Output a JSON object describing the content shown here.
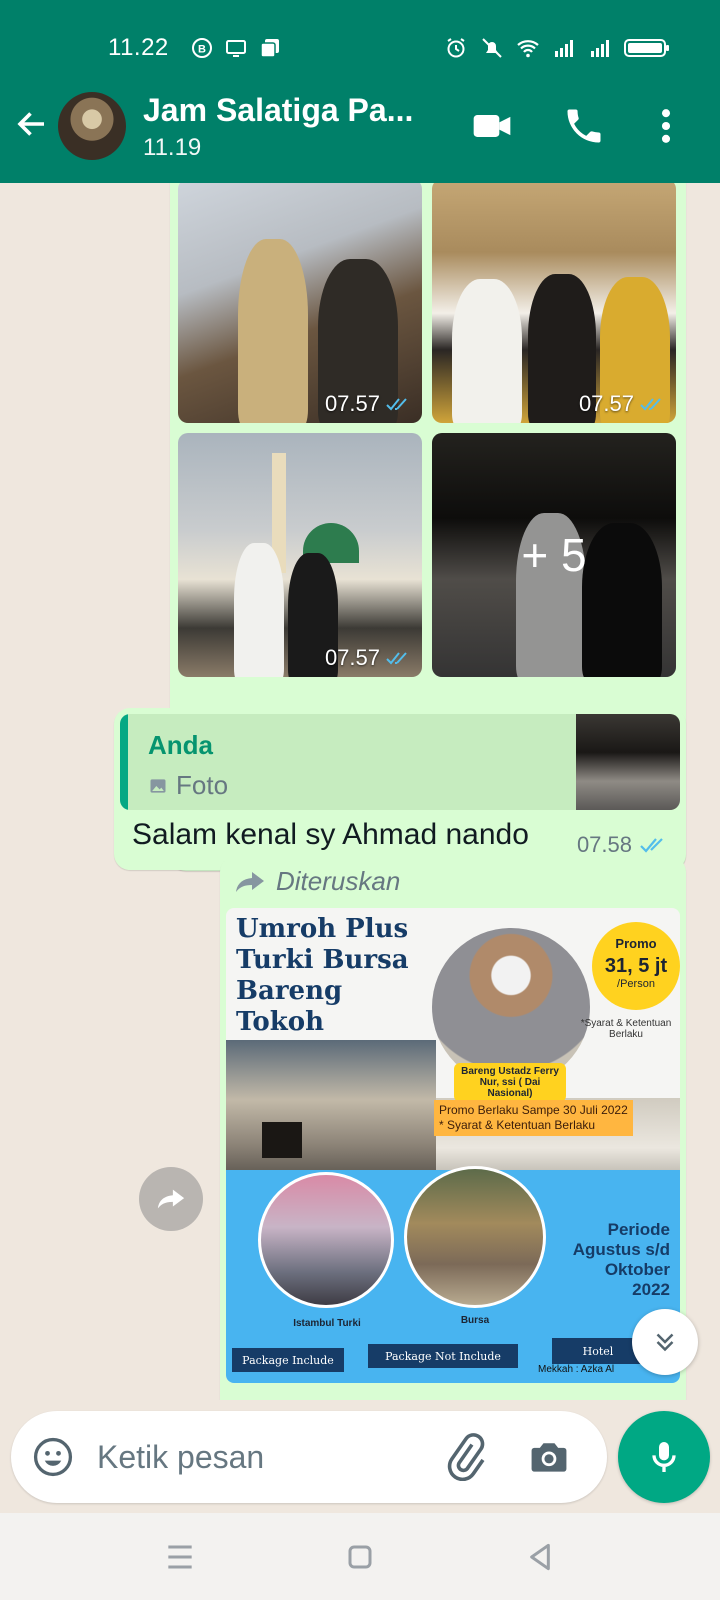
{
  "status_bar": {
    "time": "11.22",
    "left_icons": [
      "b-circle-icon",
      "cast-icon",
      "gallery-icon"
    ],
    "right_icons": [
      "alarm-icon",
      "mute-icon",
      "wifi-icon",
      "signal-icon",
      "signal-icon",
      "battery-icon"
    ]
  },
  "header": {
    "title": "Jam Salatiga Pa...",
    "subtitle": "11.19",
    "actions": [
      "video-call-icon",
      "call-icon",
      "more-options-icon"
    ]
  },
  "messages": {
    "photo_grid": {
      "tiles": [
        {
          "time": "07.57"
        },
        {
          "time": "07.57"
        },
        {
          "time": "07.57"
        },
        {
          "more_count": "+ 5"
        }
      ]
    },
    "reply": {
      "quoted_name": "Anda",
      "quoted_type": "Foto",
      "text": "Salam kenal sy Ahmad nando",
      "time": "07.58"
    },
    "forwarded": {
      "label": "Diteruskan",
      "poster": {
        "headline": [
          "Umroh Plus",
          "Turki Bursa",
          "Bareng",
          "Tokoh"
        ],
        "promo_label": "Promo",
        "promo_price": "31, 5 jt",
        "promo_unit": "/Person",
        "syarat_note": "*Syarat & Ketentuan Berlaku",
        "ustadz": "Bareng Ustadz Ferry Nur, ssi ( Dai Nasional)",
        "berlaku_line1": "Promo Berlaku Sampe 30 Juli 2022",
        "berlaku_line2": "* Syarat & Ketentuan Berlaku",
        "caption_left": "Istambul Turki",
        "caption_right": "Bursa",
        "periode": [
          "Periode",
          "Agustus s/d",
          "Oktober",
          "2022"
        ],
        "package_include": "Package Include",
        "package_not_include": "Package Not Include",
        "hotel": "Hotel",
        "mekkah": "Mekkah : Azka Al"
      }
    }
  },
  "input": {
    "placeholder": "Ketik pesan"
  },
  "colors": {
    "header": "#008069",
    "bubble_out": "#d9fdd3",
    "accent": "#00a884",
    "read_ticks": "#53bdeb"
  }
}
